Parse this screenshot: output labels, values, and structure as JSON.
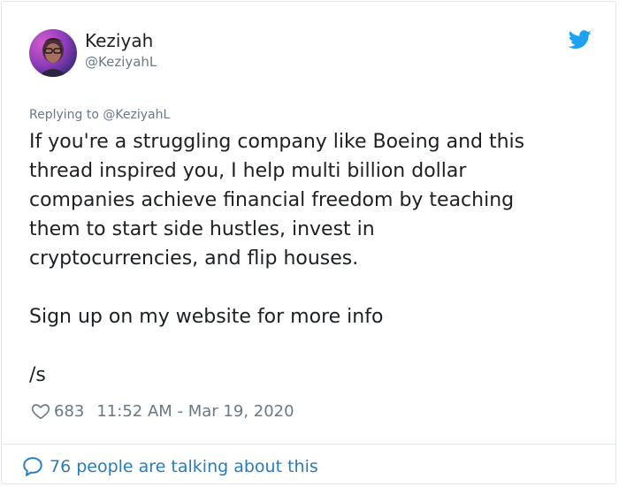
{
  "author": {
    "display_name": "Keziyah",
    "handle": "@KeziyahL",
    "avatar_icon": "avatar-photo"
  },
  "reply": {
    "prefix": "Replying to",
    "mention": "@KeziyahL"
  },
  "tweet": {
    "lines": [
      "If you're a struggling company like Boeing and this",
      "thread inspired you, I help multi billion dollar",
      "companies achieve financial freedom by teaching",
      "them to start side hustles, invest in",
      "cryptocurrencies, and flip houses."
    ],
    "paragraph2": "Sign up on my website for more info",
    "paragraph3": "/s"
  },
  "meta": {
    "likes": "683",
    "timestamp": "11:52 AM - Mar 19, 2020"
  },
  "footer": {
    "talking_text": "76 people are talking about this"
  },
  "icons": {
    "bird": "twitter-bird-icon",
    "heart": "heart-outline-icon",
    "bubble": "speech-bubble-icon"
  },
  "colors": {
    "twitter_blue": "#1da1f2",
    "link_blue": "#2b7bb9",
    "muted": "#697882",
    "text": "#1c2022",
    "border": "#e1e8ed"
  }
}
